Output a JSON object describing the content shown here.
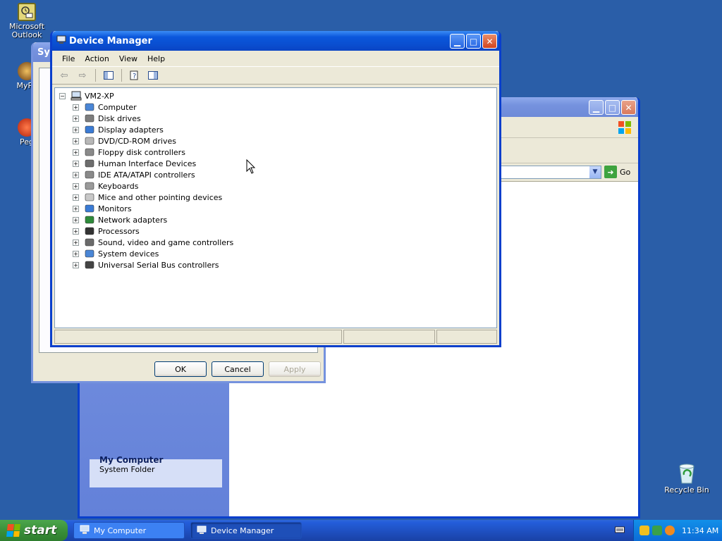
{
  "desktop": {
    "icons": [
      {
        "label": "Microsoft Outlook",
        "icon": "outlook-icon"
      },
      {
        "label": "MyPa",
        "icon": "mypal-icon"
      },
      {
        "label": "Peg",
        "icon": "pegasus-icon"
      },
      {
        "label": "Recycle Bin",
        "icon": "recycle-bin-icon"
      }
    ]
  },
  "my_computer_window": {
    "address_go": "Go",
    "details_title": "My Computer",
    "details_subtitle": "System Folder"
  },
  "system_properties_window": {
    "title": "Sys",
    "ok": "OK",
    "cancel": "Cancel",
    "apply": "Apply"
  },
  "device_manager": {
    "title": "Device Manager",
    "menu": [
      "File",
      "Action",
      "View",
      "Help"
    ],
    "root": "VM2-XP",
    "devices": [
      {
        "label": "Computer",
        "icon": "computer-icon",
        "color": "#4a86d6"
      },
      {
        "label": "Disk drives",
        "icon": "disk-drive-icon",
        "color": "#7d7d7d"
      },
      {
        "label": "Display adapters",
        "icon": "monitor-icon",
        "color": "#3a7bd5"
      },
      {
        "label": "DVD/CD-ROM drives",
        "icon": "cdrom-icon",
        "color": "#b8b8b8"
      },
      {
        "label": "Floppy disk controllers",
        "icon": "floppy-controller-icon",
        "color": "#8a8a8a"
      },
      {
        "label": "Human Interface Devices",
        "icon": "hid-icon",
        "color": "#6d6d6d"
      },
      {
        "label": "IDE ATA/ATAPI controllers",
        "icon": "ide-controller-icon",
        "color": "#8a8a8a"
      },
      {
        "label": "Keyboards",
        "icon": "keyboard-icon",
        "color": "#9a9a9a"
      },
      {
        "label": "Mice and other pointing devices",
        "icon": "mouse-icon",
        "color": "#c8c8c8"
      },
      {
        "label": "Monitors",
        "icon": "monitor-icon",
        "color": "#3a7bd5"
      },
      {
        "label": "Network adapters",
        "icon": "network-adapter-icon",
        "color": "#2e8b3a"
      },
      {
        "label": "Processors",
        "icon": "processor-icon",
        "color": "#333333"
      },
      {
        "label": "Sound, video and game controllers",
        "icon": "sound-icon",
        "color": "#6a6a6a"
      },
      {
        "label": "System devices",
        "icon": "system-device-icon",
        "color": "#4a86d6"
      },
      {
        "label": "Universal Serial Bus controllers",
        "icon": "usb-icon",
        "color": "#444444"
      }
    ]
  },
  "taskbar": {
    "start": "start",
    "buttons": [
      {
        "label": "My Computer",
        "icon": "my-computer-icon"
      },
      {
        "label": "Device Manager",
        "icon": "device-manager-icon"
      }
    ],
    "clock": "11:34 AM"
  }
}
